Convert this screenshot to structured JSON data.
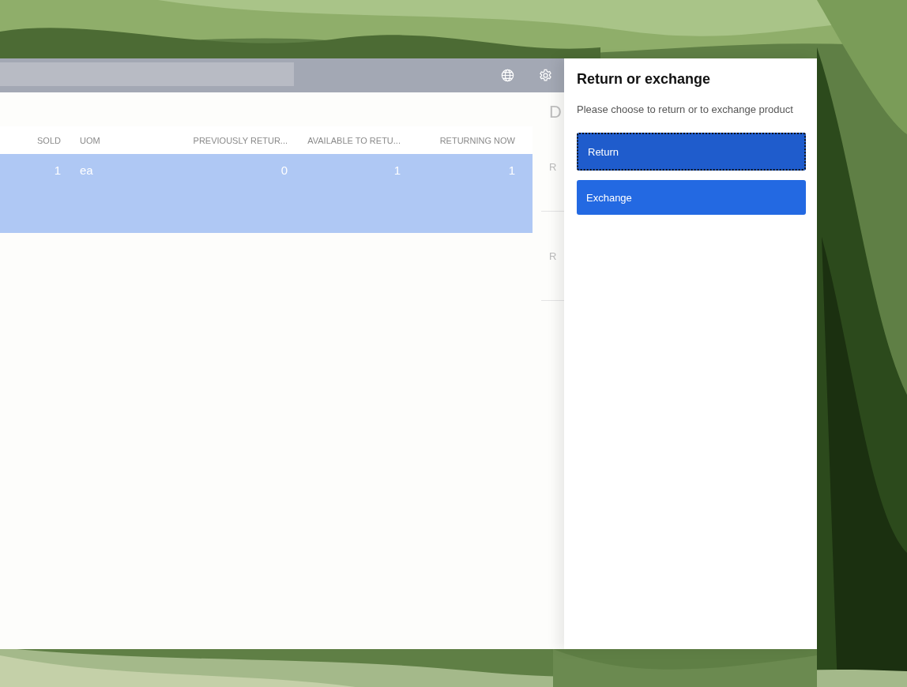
{
  "table": {
    "columns": [
      {
        "label": "SOLD"
      },
      {
        "label": "UOM"
      },
      {
        "label": "PREVIOUSLY RETUR..."
      },
      {
        "label": "AVAILABLE TO RETU..."
      },
      {
        "label": "RETURNING NOW"
      }
    ],
    "rows": [
      {
        "cells": [
          "1",
          "ea",
          "0",
          "1",
          "1"
        ],
        "selected": true
      }
    ]
  },
  "details": {
    "heading": "D",
    "labels": [
      "R",
      "R"
    ]
  },
  "dialog": {
    "title": "Return or exchange",
    "message": "Please choose to return or to exchange product",
    "options": [
      {
        "label": "Return",
        "focused": true
      },
      {
        "label": "Exchange",
        "focused": false
      }
    ]
  }
}
